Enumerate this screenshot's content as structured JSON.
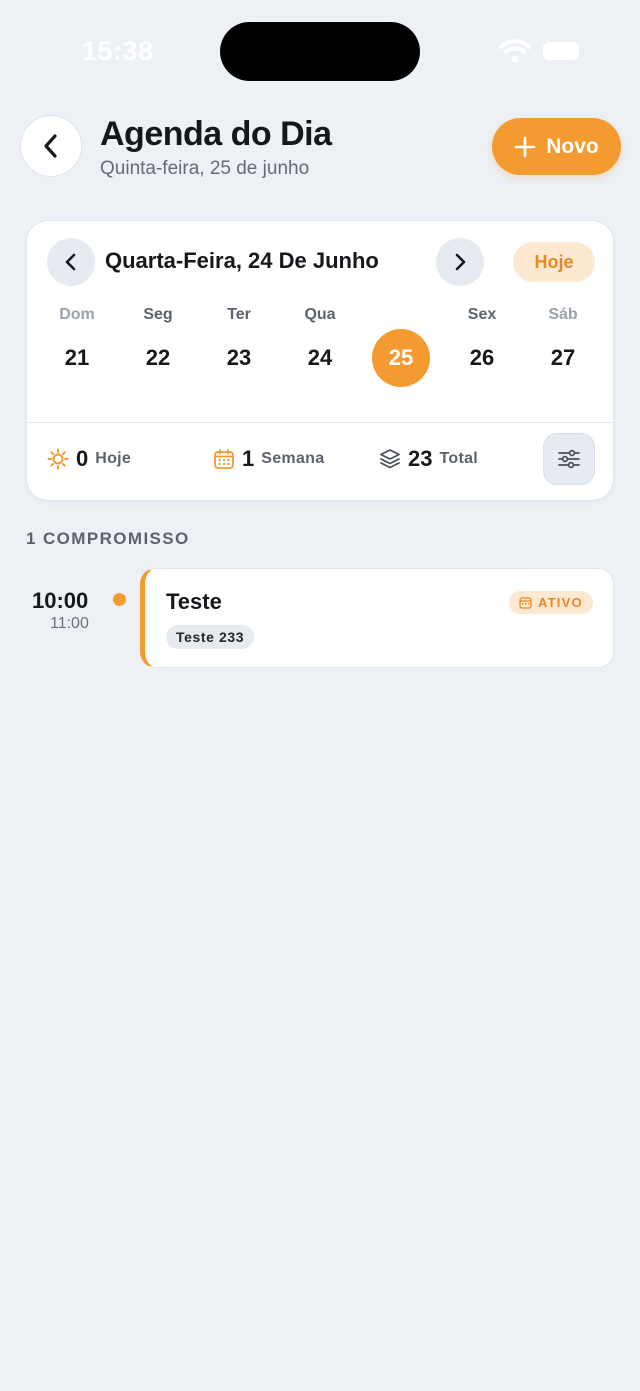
{
  "status_bar": {
    "time": "15:38"
  },
  "header": {
    "title": "Agenda do Dia",
    "subtitle": "Quinta-feira, 25 de junho",
    "new_label": "Novo"
  },
  "calendar": {
    "month_title": "Quarta-Feira, 24 De Junho",
    "today_label": "Hoje",
    "days": [
      {
        "name": "Dom",
        "number": "21"
      },
      {
        "name": "Seg",
        "number": "22"
      },
      {
        "name": "Ter",
        "number": "23"
      },
      {
        "name": "Qua",
        "number": "24"
      },
      {
        "name": "",
        "number": "25",
        "selected": true
      },
      {
        "name": "Sex",
        "number": "26"
      },
      {
        "name": "Sáb",
        "number": "27"
      }
    ],
    "stats": {
      "today": {
        "value": "0",
        "label": "Hoje"
      },
      "week": {
        "value": "1",
        "label": "Semana"
      },
      "total": {
        "value": "23",
        "label": "Total"
      }
    }
  },
  "list": {
    "section_label": "1 COMPROMISSO",
    "events": [
      {
        "start": "10:00",
        "end": "11:00",
        "title": "Teste",
        "tag": "Teste 233",
        "status": "ATIVO"
      }
    ]
  },
  "colors": {
    "accent": "#f39a30",
    "accent_soft": "#fde8d2",
    "background": "#edf1f5"
  }
}
